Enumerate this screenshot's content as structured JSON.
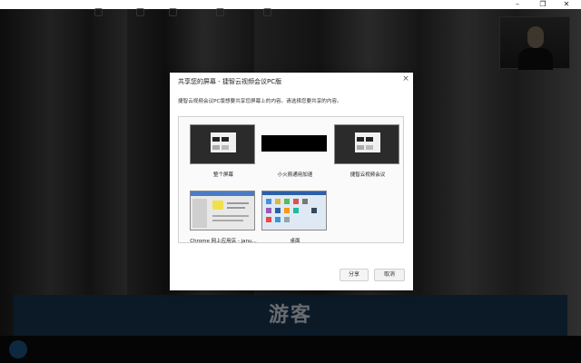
{
  "window": {
    "minimize_glyph": "–",
    "maximize_glyph": "❐",
    "close_glyph": "✕"
  },
  "video": {
    "banner_text": "游客",
    "status_tags": ""
  },
  "dialog": {
    "title": "共享您的屏幕 - 捷智云视频会议PC版",
    "close_glyph": "×",
    "description": "捷智云视频会议PC版想要共享您屏幕上的内容。请选择您要共享的内容。",
    "tiles": [
      {
        "label": "整个屏幕",
        "icon": "monitor-preview"
      },
      {
        "label": "小火箭通用加速",
        "icon": "black-window-preview"
      },
      {
        "label": "捷智云视频会议",
        "icon": "app-window-preview"
      },
      {
        "label": "Chrome 网上应用店 - janu...",
        "icon": "browser-preview"
      },
      {
        "label": "桌面",
        "icon": "desktop-preview"
      }
    ],
    "share_label": "分享",
    "cancel_label": "取消"
  },
  "toolbar": {
    "items": [
      {
        "label": "",
        "icon": "logo-icon"
      },
      {
        "label": "",
        "icon": "mic-icon"
      },
      {
        "label": "",
        "icon": "camera-icon"
      },
      {
        "label": "",
        "icon": "invite-icon"
      },
      {
        "label": "",
        "icon": "share-screen-icon"
      },
      {
        "label": "",
        "icon": "chat-icon"
      }
    ]
  },
  "colors": {
    "banner": "#1b3b59",
    "dialog_bg": "#ffffff",
    "toolbar_bg": "#0c0c0c"
  }
}
